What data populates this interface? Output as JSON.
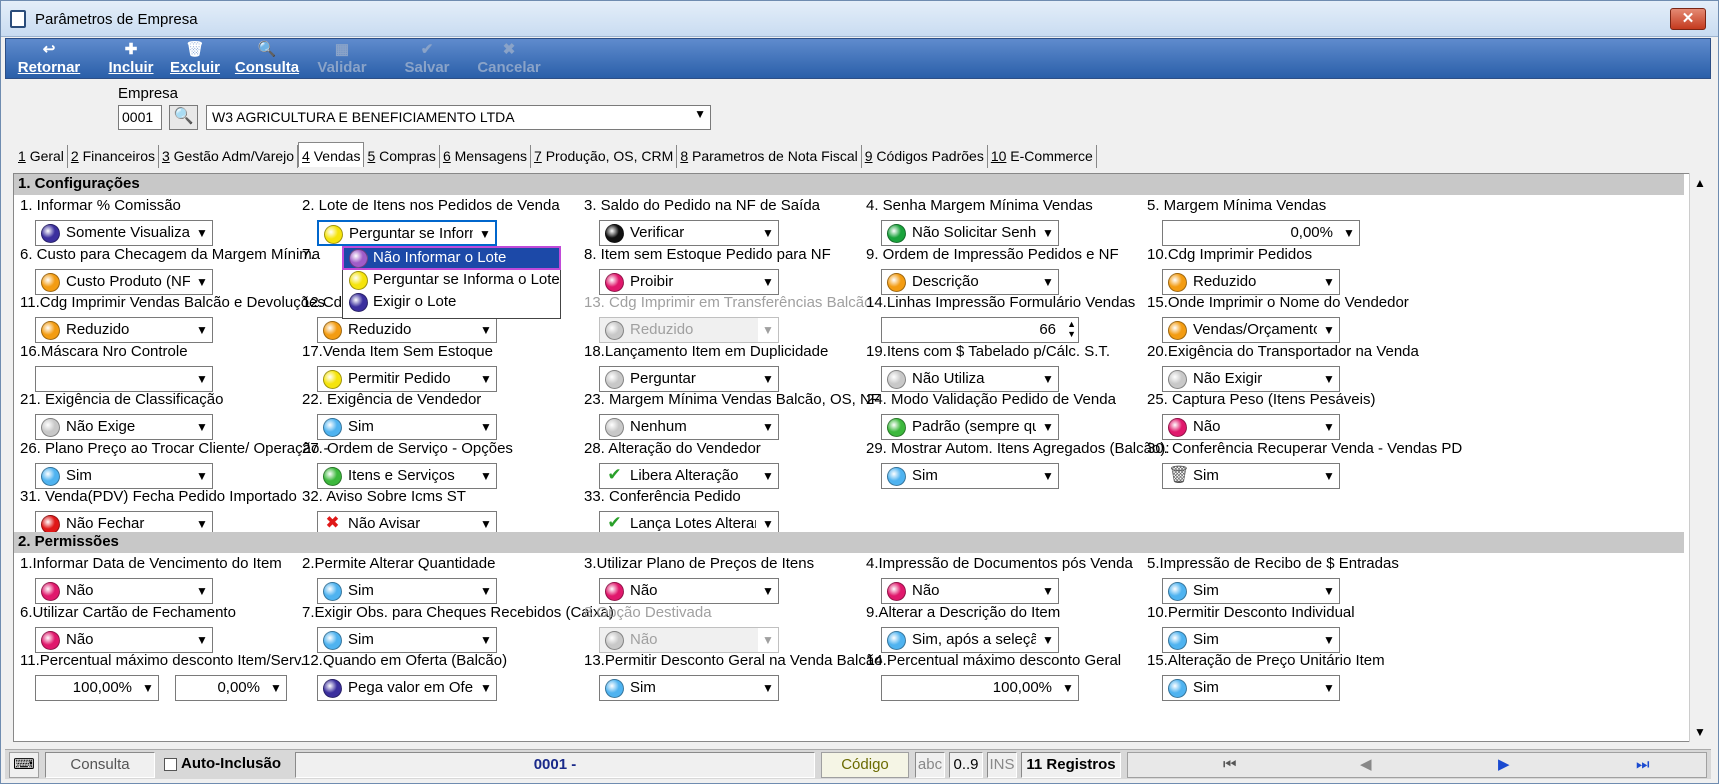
{
  "window": {
    "title": "Parâmetros de Empresa",
    "close": "✕"
  },
  "toolbar": [
    {
      "label": "Retornar",
      "icon": "↩",
      "enabled": true
    },
    {
      "label": "Incluir",
      "icon": "✚",
      "enabled": true
    },
    {
      "label": "Excluir",
      "icon": "🗑",
      "enabled": true
    },
    {
      "label": "Consulta",
      "icon": "🔍",
      "enabled": true
    },
    {
      "label": "Validar",
      "icon": "▦",
      "enabled": false
    },
    {
      "label": "Salvar",
      "icon": "✔",
      "enabled": false
    },
    {
      "label": "Cancelar",
      "icon": "✖",
      "enabled": false
    }
  ],
  "empresa": {
    "label": "Empresa",
    "code": "0001",
    "name": "W3 AGRICULTURA E BENEFICIAMENTO LTDA"
  },
  "tabs": [
    {
      "num": "1",
      "label": "Geral"
    },
    {
      "num": "2",
      "label": "Financeiros"
    },
    {
      "num": "3",
      "label": "Gestão Adm/Varejo"
    },
    {
      "num": "4",
      "label": "Vendas",
      "active": true
    },
    {
      "num": "5",
      "label": "Compras"
    },
    {
      "num": "6",
      "label": "Mensagens"
    },
    {
      "num": "7",
      "label": "Produção, OS, CRM"
    },
    {
      "num": "8",
      "label": "Parametros de Nota Fiscal"
    },
    {
      "num": "9",
      "label": "Códigos Padrões"
    },
    {
      "num": "10",
      "label": "E-Commerce"
    }
  ],
  "sections": {
    "config": "1. Configurações",
    "perm": "2. Permissões"
  },
  "config_fields": [
    {
      "label": "1. Informar % Comissão",
      "value": "Somente Visualizar",
      "color": "#3b2f9e"
    },
    {
      "label": "2. Lote de Itens nos Pedidos de Venda",
      "value": "Perguntar se Informa",
      "color": "#f5e40c",
      "focus": true
    },
    {
      "label": "3. Saldo do Pedido na NF de Saída",
      "value": "Verificar",
      "color": "#111111"
    },
    {
      "label": "4. Senha Margem Mínima Vendas",
      "value": "Não Solicitar Senha",
      "color": "#1aa33c"
    },
    {
      "label": "5. Margem Mínima Vendas",
      "value": "0,00%",
      "numeric": true
    },
    {
      "label": "6. Custo para Checagem da Margem Mínima",
      "value": "Custo Produto (NF/Re",
      "color": "#f39c12"
    },
    {
      "label": "7.",
      "value": "",
      "color": "#f5e40c",
      "covered": true
    },
    {
      "label": "8. Item sem Estoque Pedido para NF",
      "value": "Proibir",
      "color": "#e0186c"
    },
    {
      "label": "9. Ordem de Impressão Pedidos e NF",
      "value": "Descrição",
      "color": "#f39c12"
    },
    {
      "label": "10.Cdg Imprimir Pedidos",
      "value": "Reduzido",
      "color": "#f39c12"
    },
    {
      "label": "11.Cdg Imprimir Vendas Balcão e Devoluções",
      "value": "Reduzido",
      "color": "#f39c12"
    },
    {
      "label": "12.Cdg Imprimir Condicionais",
      "value": "Reduzido",
      "color": "#f39c12"
    },
    {
      "label": "13. Cdg Imprimir em Transferências Balcão",
      "value": "Reduzido",
      "color": "#c8c8c8",
      "disabled": true
    },
    {
      "label": "14.Linhas Impressão Formulário Vendas",
      "value": "66",
      "spin": true
    },
    {
      "label": "15.Onde Imprimir o Nome do Vendedor",
      "value": "Vendas/Orçamentos/(",
      "color": "#f39c12"
    },
    {
      "label": "16.Máscara Nro Controle",
      "value": "",
      "color": ""
    },
    {
      "label": "17.Venda Item Sem Estoque",
      "value": "Permitir Pedido",
      "color": "#f5e40c"
    },
    {
      "label": "18.Lançamento Item em Duplicidade",
      "value": "Perguntar",
      "color": "#c8c8c8"
    },
    {
      "label": "19.Itens com $ Tabelado p/Cálc. S.T.",
      "value": "Não Utiliza",
      "color": "#c8c8c8"
    },
    {
      "label": "20.Exigência do Transportador na Venda",
      "value": "Não Exigir",
      "color": "#c8c8c8"
    },
    {
      "label": "21. Exigência de Classificação",
      "value": "Não Exige",
      "color": "#c8c8c8"
    },
    {
      "label": "22. Exigência de Vendedor",
      "value": "Sim",
      "color": "#4fb3f0"
    },
    {
      "label": "23. Margem Mínima Vendas Balcão, OS, NF",
      "value": "Nenhum",
      "color": "#c8c8c8"
    },
    {
      "label": "24. Modo Validação Pedido de Venda",
      "value": "Padrão (sempre que in",
      "color": "#3cb83c"
    },
    {
      "label": "25. Captura Peso (Itens Pesáveis)",
      "value": "Não",
      "color": "#e0186c"
    },
    {
      "label": "26. Plano Preço ao Trocar Cliente/ Operação -",
      "value": "Sim",
      "color": "#4fb3f0"
    },
    {
      "label": "27. Ordem de Serviço - Opções",
      "value": "Itens e Serviços",
      "color": "#3cb83c"
    },
    {
      "label": "28. Alteração do Vendedor",
      "value": "Libera Alteração",
      "icon": "✔",
      "iconColor": "#2aa02a"
    },
    {
      "label": "29. Mostrar Autom. Itens Agregados (Balcão):",
      "value": "Sim",
      "color": "#4fb3f0"
    },
    {
      "label": "30. Conferência Recuperar Venda - Vendas PD",
      "value": "Sim",
      "icon": "🗑",
      "iconColor": "#555555"
    },
    {
      "label": "31. Venda(PDV) Fecha Pedido Importado",
      "value": "Não Fechar",
      "color": "#e01818"
    },
    {
      "label": "32. Aviso Sobre Icms ST",
      "value": "Não Avisar",
      "icon": "✖",
      "iconColor": "#e01818"
    },
    {
      "label": "33. Conferência Pedido",
      "value": "Lança Lotes Alterando",
      "icon": "✔",
      "iconColor": "#2aa02a"
    }
  ],
  "perm_fields": [
    {
      "label": "1.Informar Data de Vencimento do Item",
      "value": "Não",
      "color": "#e0186c"
    },
    {
      "label": "2.Permite Alterar Quantidade",
      "value": "Sim",
      "color": "#4fb3f0"
    },
    {
      "label": "3.Utilizar Plano de Preços de Itens",
      "value": "Não",
      "color": "#e0186c"
    },
    {
      "label": "4.Impressão de Documentos pós Venda",
      "value": "Não",
      "color": "#e0186c"
    },
    {
      "label": "5.Impressão de Recibo de $ Entradas",
      "value": "Sim",
      "color": "#4fb3f0"
    },
    {
      "label": "6.Utilizar Cartão de Fechamento",
      "value": "Não",
      "color": "#e0186c"
    },
    {
      "label": "7.Exigir Obs. para Cheques Recebidos (Caixa)",
      "value": "Sim",
      "color": "#4fb3f0"
    },
    {
      "label": "8.Opção Destivada",
      "value": "Não",
      "color": "#c8c8c8",
      "disabled": true
    },
    {
      "label": "9.Alterar a Descrição do Item",
      "value": "Sim, após a seleção do",
      "color": "#4fb3f0"
    },
    {
      "label": "10.Permitir Desconto Individual",
      "value": "Sim",
      "color": "#4fb3f0"
    },
    {
      "label": "11.Percentual máximo desconto Item/Serv.",
      "value": "100,00%",
      "value2": "0,00%",
      "dual": true
    },
    {
      "label": "12.Quando em Oferta (Balcão)",
      "value": "Pega valor em Oferta",
      "color": "#3b2f9e"
    },
    {
      "label": "13.Permitir Desconto Geral na Venda Balcão",
      "value": "Sim",
      "color": "#4fb3f0"
    },
    {
      "label": "14.Percentual máximo desconto Geral",
      "value": "100,00%",
      "numeric": true
    },
    {
      "label": "15.Alteração de Preço Unitário Item",
      "value": "Sim",
      "color": "#4fb3f0"
    }
  ],
  "dropdown": {
    "options": [
      {
        "label": "Não Informar o Lote",
        "color": "#a05cc8",
        "selected": true
      },
      {
        "label": "Perguntar se Informa o Lote",
        "color": "#f5e40c"
      },
      {
        "label": "Exigir o Lote",
        "color": "#3b2f9e"
      }
    ]
  },
  "status": {
    "mode": "Consulta",
    "auto": "Auto-Inclusão",
    "record": "0001 -",
    "field": "Código",
    "abc": "abc",
    "range": "0..9",
    "ins": "INS",
    "count": "11 Registros",
    "first": "⏮",
    "prev": "◀",
    "next": "▶",
    "last": "⏭"
  }
}
